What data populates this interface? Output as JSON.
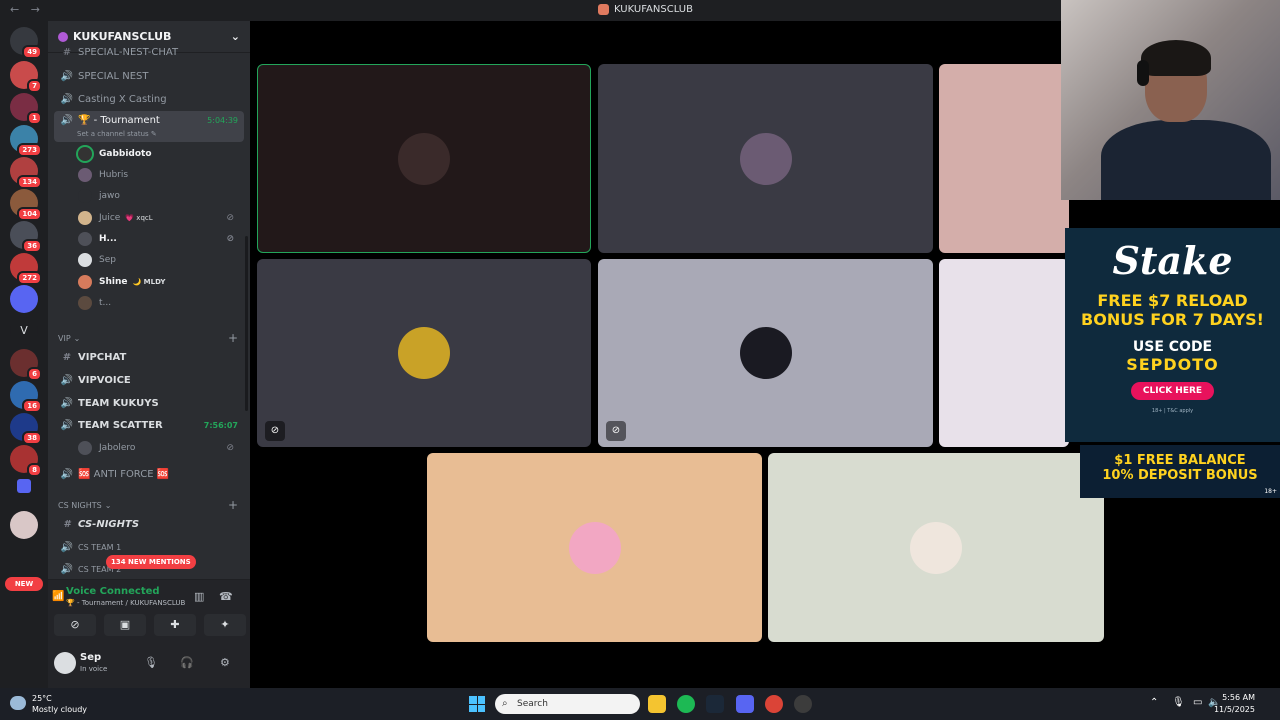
{
  "titlebar": {
    "back": "←",
    "forward": "→",
    "title": "KUKUFANSCLUB"
  },
  "servers": {
    "badges": [
      "49",
      "7",
      "1",
      "273",
      "134",
      "104",
      "36",
      "272",
      "6",
      "16",
      "38",
      "8"
    ],
    "letter": "V",
    "new_label": "NEW"
  },
  "guild": {
    "name": "KUKUFANSCLUB",
    "chevron": "⌄"
  },
  "channels": {
    "top_partial": "SPECIAL-NEST-CHAT",
    "special_nest": "SPECIAL NEST",
    "casting": "Casting X Casting",
    "tournament": {
      "name": "🏆 - Tournament",
      "time": "5:04:39",
      "status": "Set a channel status ✎"
    },
    "members": [
      {
        "name": "Gabbidoto",
        "tag": ""
      },
      {
        "name": "Hubris",
        "tag": ""
      },
      {
        "name": "jawo",
        "tag": ""
      },
      {
        "name": "Juice",
        "tag": "💗 xqcL"
      },
      {
        "name": "H...",
        "tag": ""
      },
      {
        "name": "Sep",
        "tag": ""
      },
      {
        "name": "Shine",
        "tag": "🌙 MLDY"
      },
      {
        "name": "t...",
        "tag": ""
      }
    ],
    "vip_category": "VIP",
    "vipchat": "VIPCHAT",
    "vipvoice": "VIPVOICE",
    "team_kukuys": "TEAM KUKUYS",
    "team_scatter": {
      "name": "TEAM SCATTER",
      "time": "7:56:07"
    },
    "jabolero": "Jabolero",
    "anti_force": "🆘 ANTI FORCE 🆘",
    "cs_category": "CS NIGHTS",
    "cs_nights": "CS-NIGHTS",
    "cs_team1": "CS TEAM 1",
    "cs_team2": "CS TEAM 2",
    "mentions": "134 NEW MENTIONS"
  },
  "voice": {
    "status": "Voice Connected",
    "location": "🏆 - Tournament / KUKUFANSCLUB"
  },
  "user": {
    "name": "Sep",
    "status": "In voice"
  },
  "ad": {
    "logo": "Stake",
    "offer": "FREE $7 RELOAD BONUS FOR 7 DAYS!",
    "use_code": "USE CODE",
    "code": "SEPDOTO",
    "cta": "CLICK HERE",
    "fine": "18+ | T&C apply",
    "banner_line1": "$1 FREE BALANCE",
    "banner_line2": "10% DEPOSIT BONUS",
    "banner_age": "18+"
  },
  "taskbar": {
    "temp": "25°C",
    "weather": "Mostly cloudy",
    "search_placeholder": "Search",
    "time": "5:56 AM",
    "date": "11/5/2025"
  }
}
